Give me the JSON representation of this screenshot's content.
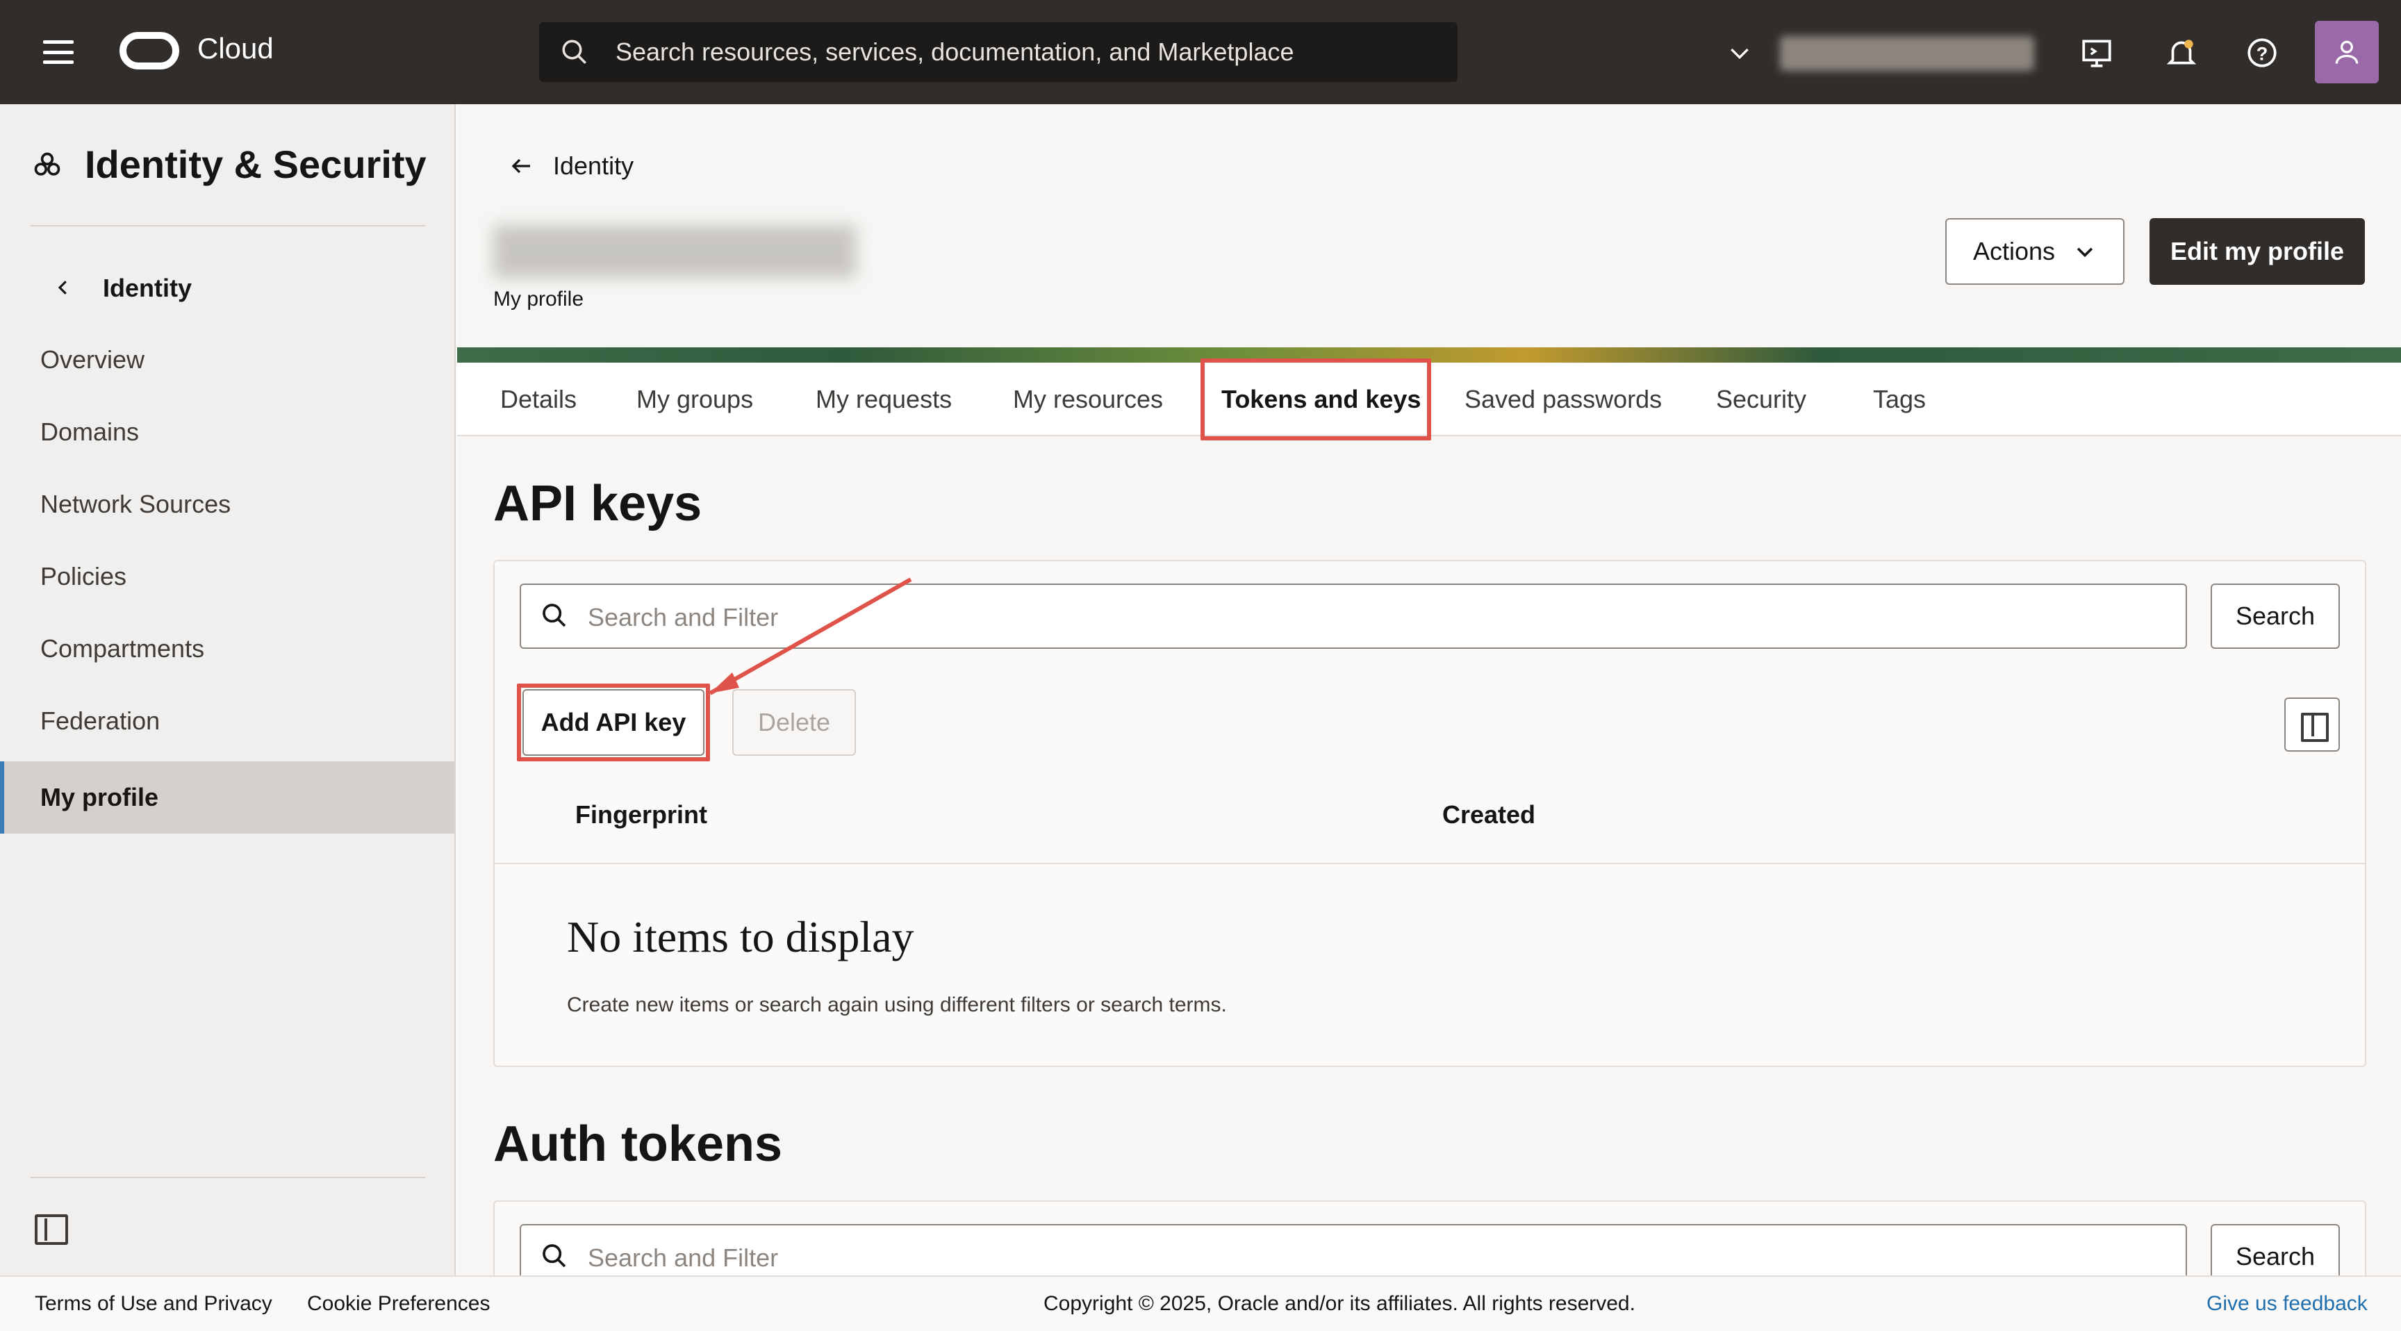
{
  "topbar": {
    "brand": "Cloud",
    "search_placeholder": "Search resources, services, documentation, and Marketplace"
  },
  "sidebar": {
    "title": "Identity & Security",
    "back_label": "Identity",
    "items": [
      {
        "label": "Overview"
      },
      {
        "label": "Domains"
      },
      {
        "label": "Network Sources"
      },
      {
        "label": "Policies"
      },
      {
        "label": "Compartments"
      },
      {
        "label": "Federation"
      },
      {
        "label": "My profile"
      }
    ]
  },
  "header": {
    "back_label": "Identity",
    "subtitle": "My profile",
    "actions_label": "Actions",
    "edit_label": "Edit my profile"
  },
  "tabs": [
    {
      "label": "Details"
    },
    {
      "label": "My groups"
    },
    {
      "label": "My requests"
    },
    {
      "label": "My resources"
    },
    {
      "label": "Tokens and keys"
    },
    {
      "label": "Saved passwords"
    },
    {
      "label": "Security"
    },
    {
      "label": "Tags"
    }
  ],
  "active_tab": "Tokens and keys",
  "api_keys": {
    "heading": "API keys",
    "search_placeholder": "Search and Filter",
    "search_button": "Search",
    "add_button": "Add API key",
    "delete_button": "Delete",
    "columns": [
      "Fingerprint",
      "Created"
    ],
    "empty_title": "No items to display",
    "empty_sub": "Create new items or search again using different filters or search terms."
  },
  "auth_tokens": {
    "heading": "Auth tokens",
    "search_placeholder": "Search and Filter",
    "search_button": "Search"
  },
  "footer": {
    "terms": "Terms of Use and Privacy",
    "cookies": "Cookie Preferences",
    "copyright": "Copyright © 2025, Oracle and/or its affiliates. All rights reserved.",
    "feedback": "Give us feedback"
  },
  "colors": {
    "topbar": "#312d2a",
    "highlight": "#e0534a",
    "active_indicator": "#3b7bb8",
    "link": "#1f6fae"
  }
}
